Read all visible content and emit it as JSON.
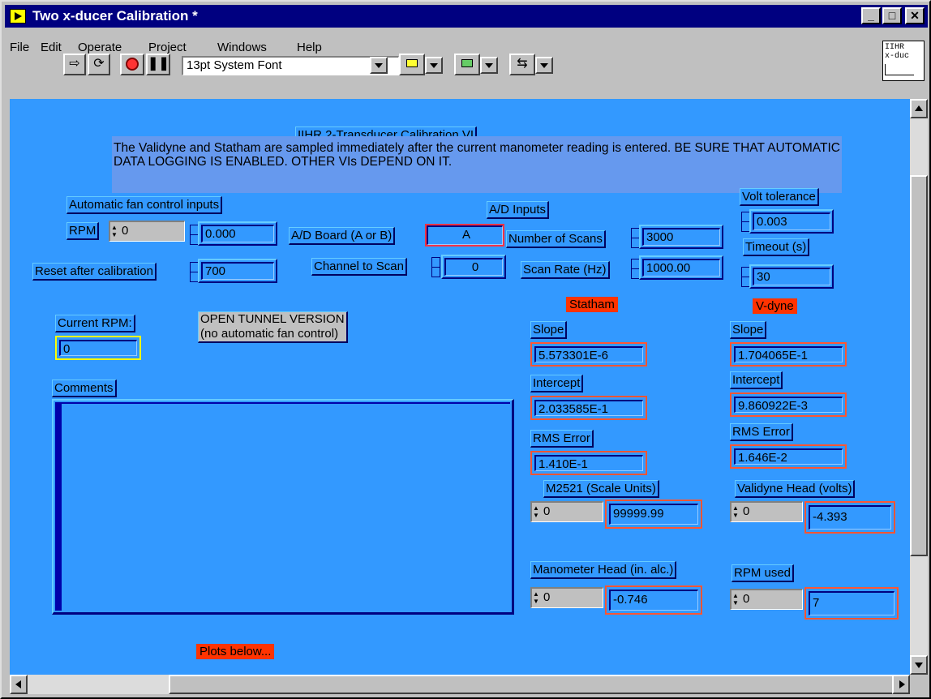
{
  "window": {
    "title": "Two x-ducer Calibration *"
  },
  "titlebar_buttons": {
    "minimize": "_",
    "maximize": "□",
    "close": "✕"
  },
  "menu": [
    "File",
    "Edit",
    "Operate",
    "Project",
    "Windows",
    "Help"
  ],
  "toolbar": {
    "font": "13pt System Font",
    "run_icon": "run-arrow-icon",
    "run_continuous_icon": "run-continuous-icon",
    "abort_icon": "abort-stop-icon",
    "pause_icon": "pause-icon"
  },
  "vi_icon": {
    "line1": "IIHR",
    "line2": "x-duc"
  },
  "panel": {
    "heading": "IIHR 2-Transducer Calibration VI",
    "description": "The Validyne and Statham are sampled immediately after the current manometer reading is entered.  BE SURE THAT AUTOMATIC DATA LOGGING IS ENABLED.  OTHER VIs DEPEND ON IT.",
    "fan_inputs_label": "Automatic fan control inputs",
    "rpm_label": "RPM",
    "rpm_value": "0",
    "rpm_display": "0.000",
    "reset_label": "Reset after calibration",
    "reset_value": "700",
    "ad_inputs_label": "A/D Inputs",
    "ad_board_label": "A/D Board (A or B)",
    "ad_board_value": "A",
    "channel_label": "Channel to Scan",
    "channel_value": "0",
    "num_scans_label": "Number of Scans",
    "num_scans_value": "3000",
    "scan_rate_label": "Scan Rate (Hz)",
    "scan_rate_value": "1000.00",
    "volt_tol_label": "Volt tolerance",
    "volt_tol_value": "0.003",
    "timeout_label": "Timeout (s)",
    "timeout_value": "30",
    "current_rpm_label": "Current RPM:",
    "current_rpm_value": "0",
    "open_tunnel_line1": "OPEN TUNNEL VERSION",
    "open_tunnel_line2": "(no automatic fan control)",
    "comments_label": "Comments",
    "plots_button": "Plots below...",
    "statham": {
      "title": "Statham",
      "slope_label": "Slope",
      "slope": "5.573301E-6",
      "intercept_label": "Intercept",
      "intercept": "2.033585E-1",
      "rms_label": "RMS Error",
      "rms": "1.410E-1",
      "m2521_label": "M2521 (Scale Units)",
      "m2521_ctl": "0",
      "m2521_value": "99999.99"
    },
    "vdyne": {
      "title": "V-dyne",
      "slope_label": "Slope",
      "slope": "1.704065E-1",
      "intercept_label": "Intercept",
      "intercept": "9.860922E-3",
      "rms_label": "RMS Error",
      "rms": "1.646E-2",
      "head_label": "Validyne Head (volts)",
      "head_ctl": "0",
      "head_value": "-4.393"
    },
    "manometer_label": "Manometer Head (in. alc.)",
    "manometer_ctl": "0",
    "manometer_value": "-0.746",
    "rpm_used_label": "RPM used",
    "rpm_used_ctl": "0",
    "rpm_used_value": "7"
  },
  "colors": {
    "panel_bg": "#3399ff",
    "titlebar": "#000080",
    "indicator_border": "#ff5533",
    "red_label": "#ff3300",
    "current_rpm_border": "#ffff00"
  }
}
